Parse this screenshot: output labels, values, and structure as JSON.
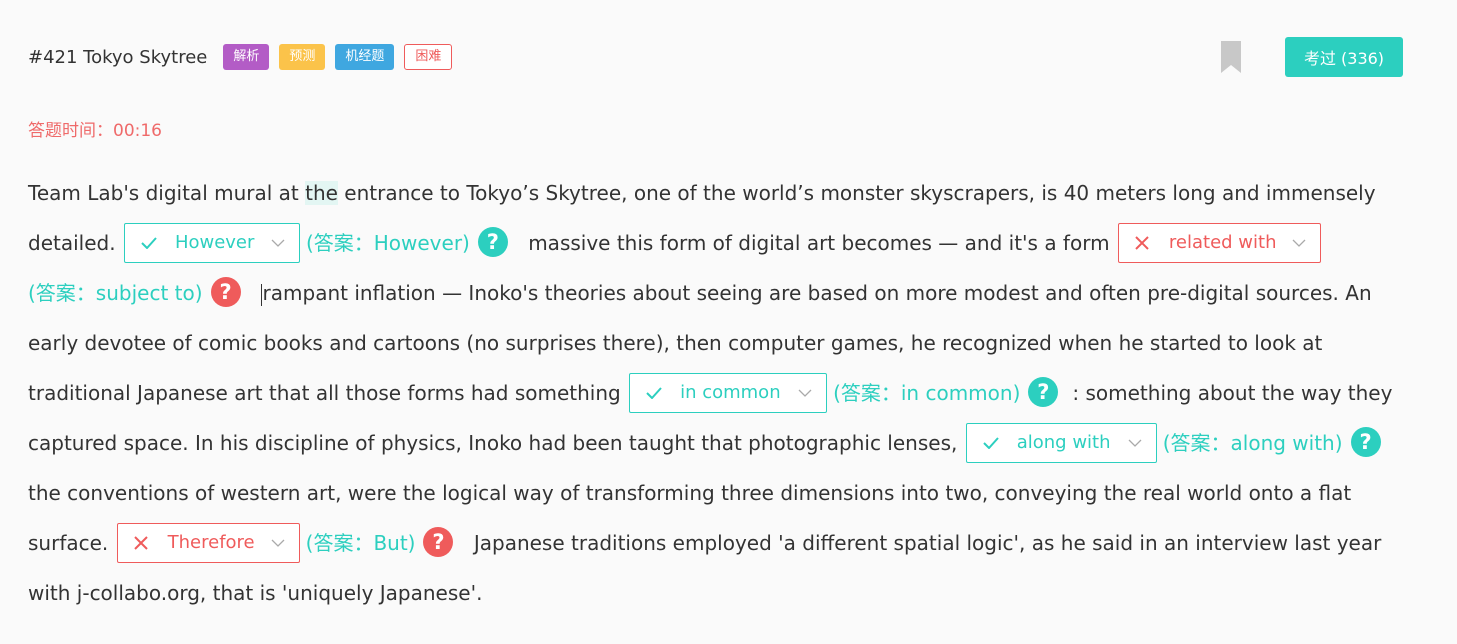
{
  "header": {
    "title": "#421 Tokyo Skytree",
    "tags": [
      "解析",
      "预测",
      "机经题",
      "困难"
    ],
    "taken_button": "考过 (336)"
  },
  "timer": {
    "label": "答题时间：",
    "value": "00:16"
  },
  "passage": {
    "t1": "Team Lab's digital mural at ",
    "t1_hl": "the",
    "t2": " entrance to Tokyo’s Skytree, one of the world’s monster skyscrapers, is 40 meters long and immensely detailed.",
    "t3": " massive this form of digital art becomes — and it's a form",
    "t4": "rampant inflation — Inoko's theories about seeing are based on more modest and often pre-digital sources. An early devotee of comic books and cartoons (no surprises there), then computer games, he recognized when he started to look at traditional Japanese art that all those forms had something",
    "t5": ": something about the way they captured space. In his discipline of physics, Inoko had been taught that photographic lenses,",
    "t6": "the conventions of western art, were the logical way of transforming three dimensions into two, conveying the real world onto a flat surface.",
    "t7": " Japanese traditions employed 'a different spatial logic', as he said in an interview last year with j-collabo.org, that is 'uniquely Japanese'."
  },
  "blanks": [
    {
      "selected": "However",
      "answer": "(答案：However)",
      "status": "correct"
    },
    {
      "selected": "related with",
      "answer": "(答案：subject to)",
      "status": "wrong"
    },
    {
      "selected": "in common",
      "answer": "(答案：in common)",
      "status": "correct"
    },
    {
      "selected": "along with",
      "answer": "(答案：along with)",
      "status": "correct"
    },
    {
      "selected": "Therefore",
      "answer": "(答案：But)",
      "status": "wrong"
    }
  ],
  "colors": {
    "accent": "#2ccfbf",
    "error": "#ef5b5b"
  },
  "icons": {
    "help": "?"
  }
}
